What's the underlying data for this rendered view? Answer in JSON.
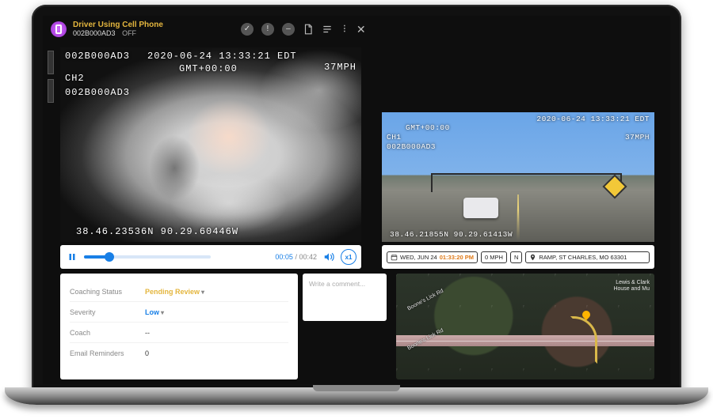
{
  "header": {
    "event_title": "Driver Using Cell Phone",
    "device_id": "002B000AD3",
    "status_tag": "OFF",
    "icons": [
      "check",
      "alert",
      "disable",
      "doc",
      "list",
      "more",
      "close"
    ]
  },
  "camera_main": {
    "device_id": "002B000AD3",
    "timestamp": "2020-06-24 13:33:21 EDT",
    "tz": "GMT+00:00",
    "channel": "CH2",
    "device_id2": "002B000AD3",
    "speed": "37MPH",
    "coords": "38.46.23536N 90.29.60446W"
  },
  "camera_sec": {
    "timestamp": "2020-06-24 13:33:21 EDT",
    "tz": "GMT+00:00",
    "channel": "CH1",
    "device_id": "002B000AD3",
    "speed": "37MPH",
    "coords": "38.46.21855N 90.29.61413W"
  },
  "playback": {
    "elapsed": "00:05",
    "duration": "00:42",
    "rate": "x1"
  },
  "info": {
    "date": "WED, JUN 24",
    "time": "01:33:20 PM",
    "speed": "0 MPH",
    "heading": "N",
    "location": "RAMP, ST CHARLES, MO 63301"
  },
  "coaching": {
    "status_label": "Coaching Status",
    "status_value": "Pending Review",
    "severity_label": "Severity",
    "severity_value": "Low",
    "coach_label": "Coach",
    "coach_value": "--",
    "reminders_label": "Email Reminders",
    "reminders_value": "0"
  },
  "comment": {
    "placeholder": "Write a comment..."
  },
  "map": {
    "road_label": "Boone's Lick Rd",
    "poi_line1": "Lewis & Clark",
    "poi_line2": "House and Mu"
  }
}
